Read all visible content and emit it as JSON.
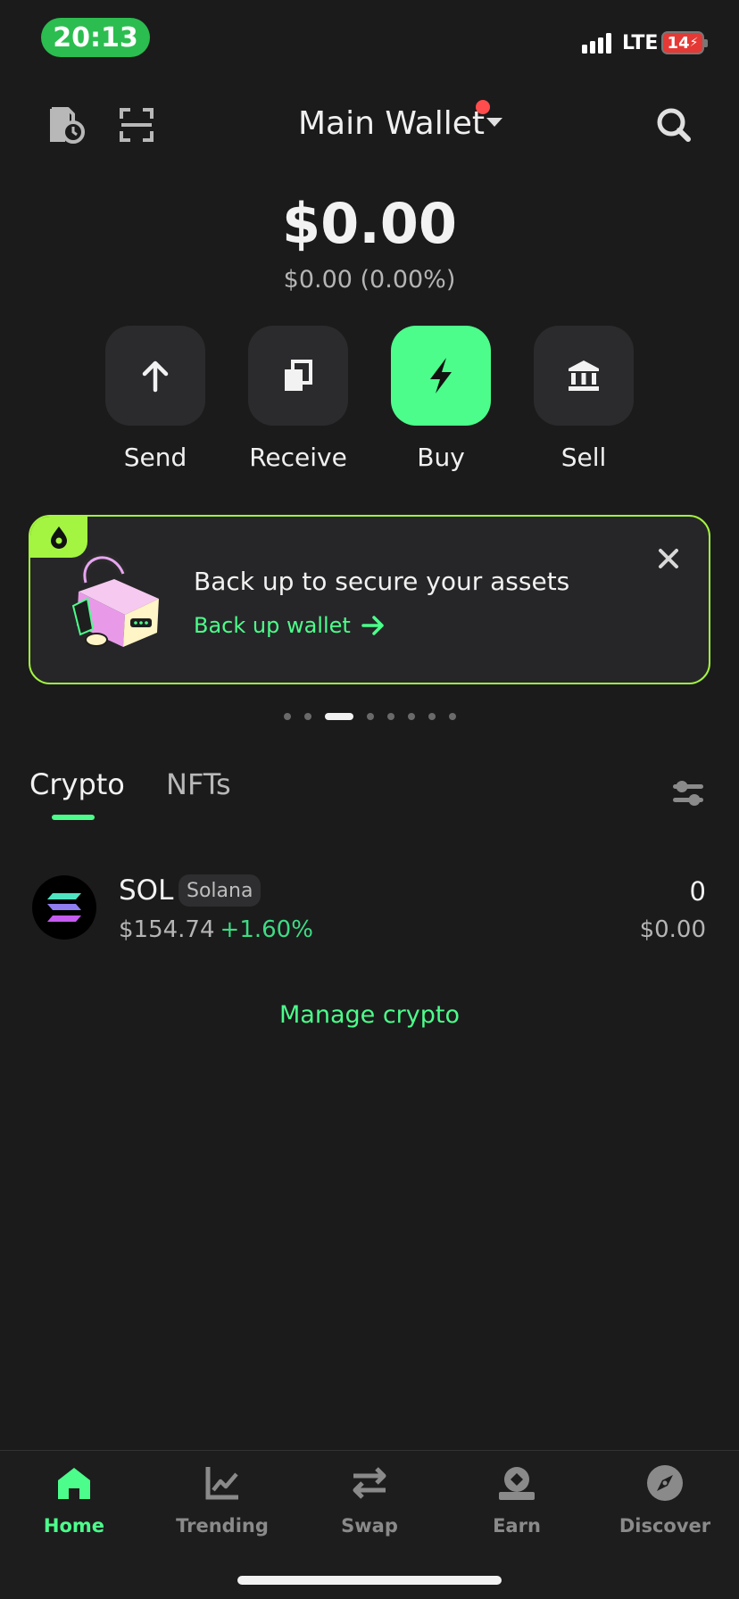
{
  "status_bar": {
    "time": "20:13",
    "network": "LTE",
    "battery": "14",
    "icons": [
      "signal-icon",
      "battery-charging-icon"
    ]
  },
  "header": {
    "wallet_name": "Main Wallet",
    "left_icons": [
      "history-icon",
      "scan-icon"
    ],
    "right_icon": "search-icon",
    "notification_dot_color": "#ff4d4d"
  },
  "balance": {
    "total": "$0.00",
    "change": "$0.00 (0.00%)"
  },
  "actions": [
    {
      "label": "Send",
      "icon": "arrow-up-icon"
    },
    {
      "label": "Receive",
      "icon": "copy-icon"
    },
    {
      "label": "Buy",
      "icon": "lightning-icon"
    },
    {
      "label": "Sell",
      "icon": "bank-icon"
    }
  ],
  "banner": {
    "title": "Back up to secure your assets",
    "link": "Back up wallet",
    "icons": [
      "drop-icon",
      "padlock-illustration",
      "close-icon",
      "arrow-right-icon"
    ],
    "border_color": "#a3f542",
    "carousel_active_index": 2,
    "carousel_count": 8
  },
  "tabs": {
    "crypto": "Crypto",
    "nfts": "NFTs",
    "active": "Crypto",
    "filter_icon": "sliders-icon"
  },
  "tokens": [
    {
      "symbol": "SOL",
      "chain": "Solana",
      "price": "$154.74",
      "change": "+1.60%",
      "amount": "0",
      "value": "$0.00",
      "icon": "solana-logo-icon"
    }
  ],
  "manage_crypto": "Manage crypto",
  "bottom_nav": [
    {
      "label": "Home",
      "icon": "home-icon",
      "active": true
    },
    {
      "label": "Trending",
      "icon": "chart-icon",
      "active": false
    },
    {
      "label": "Swap",
      "icon": "swap-icon",
      "active": false
    },
    {
      "label": "Earn",
      "icon": "earn-icon",
      "active": false
    },
    {
      "label": "Discover",
      "icon": "compass-icon",
      "active": false
    }
  ],
  "colors": {
    "background": "#1b1b1b",
    "accent": "#4cfd8b",
    "positive": "#3ddc84"
  }
}
